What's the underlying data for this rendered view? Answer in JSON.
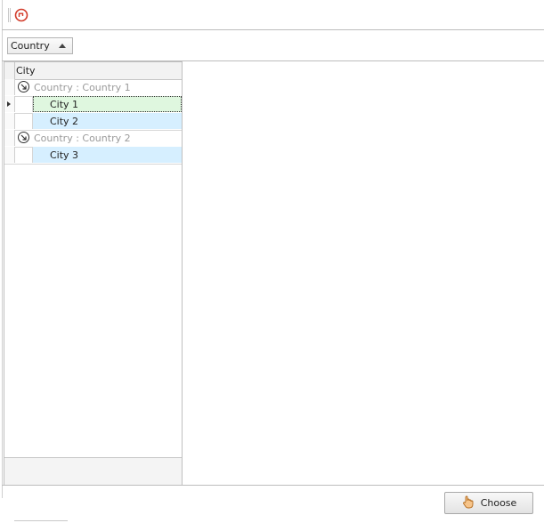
{
  "group_panel": {
    "chip_label": "Country"
  },
  "grid": {
    "column_header": "City",
    "groups": [
      {
        "label": "Country : Country 1",
        "rows": [
          "City 1",
          "City 2"
        ]
      },
      {
        "label": "Country : Country 2",
        "rows": [
          "City 3"
        ]
      }
    ]
  },
  "footer": {
    "choose_label": "Choose"
  },
  "colors": {
    "focused_row": "#dff7df",
    "selected_row": "#d6efff",
    "group_text": "#9a9a9a"
  }
}
